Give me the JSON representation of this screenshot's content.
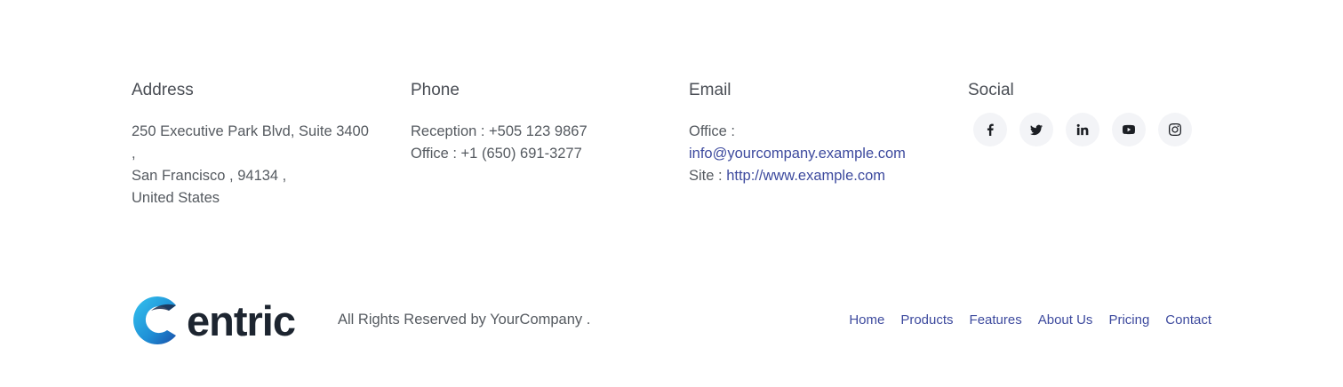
{
  "address": {
    "heading": "Address",
    "lines": [
      "250 Executive Park Blvd, Suite 3400",
      ",",
      "San Francisco , 94134 ,",
      "United States"
    ]
  },
  "phone": {
    "heading": "Phone",
    "reception": "Reception : +505 123 9867",
    "office": "Office : +1 (650) 691-3277"
  },
  "email": {
    "heading": "Email",
    "office_label": "Office :",
    "office_email": "info@yourcompany.example.com",
    "site_label": "Site :",
    "site_url": "http://www.example.com"
  },
  "social": {
    "heading": "Social",
    "icons": [
      "facebook-icon",
      "twitter-icon",
      "linkedin-icon",
      "youtube-icon",
      "instagram-icon"
    ]
  },
  "footer": {
    "logo_text": "entric",
    "copyright": "All Rights Reserved by YourCompany .",
    "nav": [
      "Home",
      "Products",
      "Features",
      "About Us",
      "Pricing",
      "Contact"
    ]
  },
  "colors": {
    "link": "#3d4a9e",
    "logo_blue": "#1f8fd6",
    "logo_text": "#1d2530"
  }
}
